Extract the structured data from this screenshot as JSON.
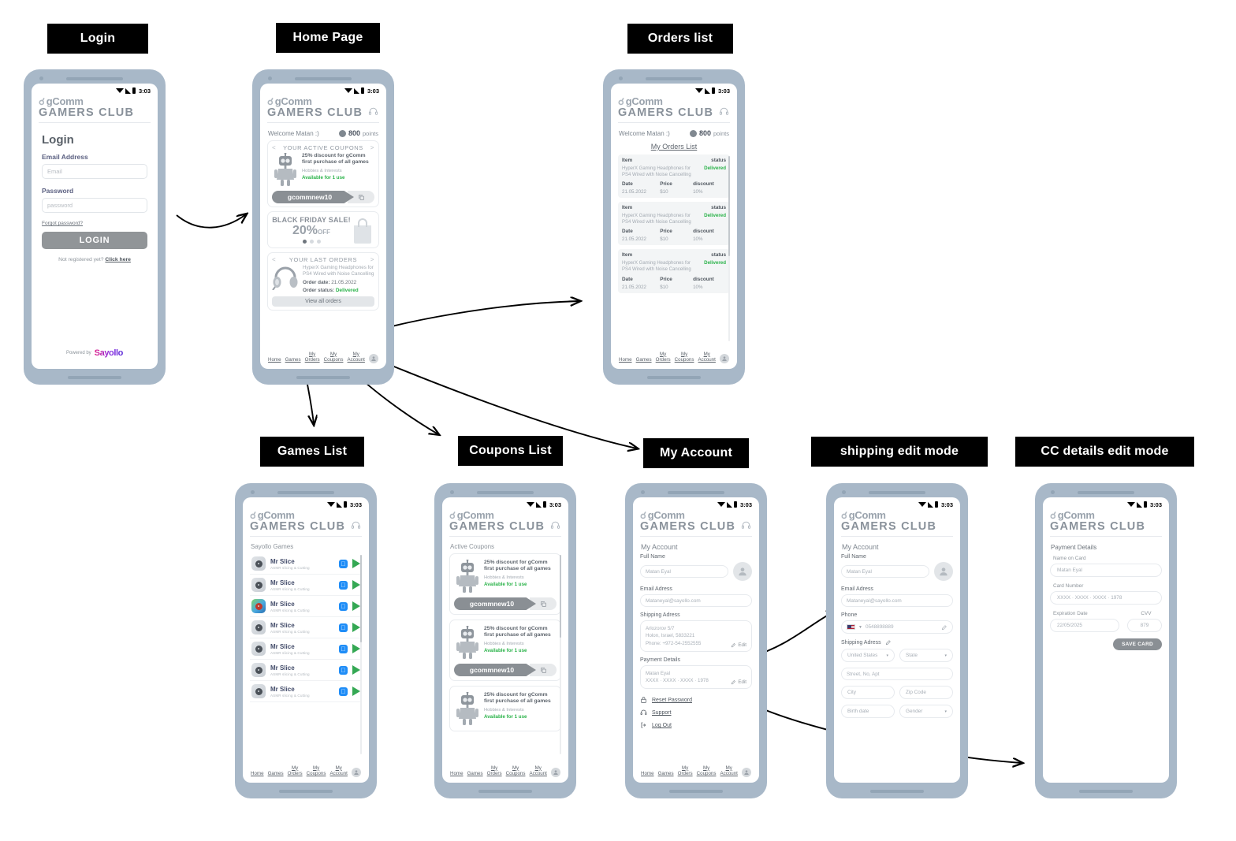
{
  "flow_labels": [
    {
      "id": "login",
      "text": "Login"
    },
    {
      "id": "home",
      "text": "Home Page"
    },
    {
      "id": "orders",
      "text": "Orders list"
    },
    {
      "id": "games",
      "text": "Games List"
    },
    {
      "id": "coupons",
      "text": "Coupons List"
    },
    {
      "id": "account",
      "text": "My Account"
    },
    {
      "id": "shipping",
      "text": "shipping edit mode"
    },
    {
      "id": "cc",
      "text": "CC details edit mode"
    }
  ],
  "status_bar": {
    "time": "3:03"
  },
  "brand": {
    "name": "gComm",
    "club": "GAMERS CLUB"
  },
  "welcome": {
    "text": "Welcome  Matan :)",
    "points_value": "800",
    "points_label": "points"
  },
  "bottom_nav": [
    {
      "line1": "Home",
      "line2": ""
    },
    {
      "line1": "Games",
      "line2": ""
    },
    {
      "line1": "My",
      "line2": "Orders"
    },
    {
      "line1": "My",
      "line2": "Coupons"
    },
    {
      "line1": "My",
      "line2": "Account"
    }
  ],
  "login": {
    "title": "Login",
    "email_label": "Email Address",
    "email_placeholder": "Email",
    "password_label": "Password",
    "password_placeholder": "password",
    "forgot": "Forgot password?",
    "button": "LOGIN",
    "not_registered": "Not registered yet?",
    "click_here": "Click here",
    "powered_by": "Powered by",
    "powered_logo": "Sayollo"
  },
  "home": {
    "coupons_card": {
      "title": "YOUR ACTIVE COUPONS",
      "prev": "<",
      "next": ">",
      "headline": "25% discount for gComm first purchase of all games",
      "category": "Hobbies & Interests",
      "availability": "Available for 1 use",
      "code": "gcommnew10"
    },
    "promo": {
      "title": "BLACK FRIDAY SALE!",
      "percent": "20%",
      "off": "OFF",
      "dots": 3,
      "active_dot": 0
    },
    "orders_card": {
      "title": "YOUR LAST ORDERS",
      "prev": "<",
      "next": ">",
      "product": "HyperX Gaming Headphones for PS4 Wired with Noise Cancelling",
      "order_date_label": "Order date:",
      "order_date": "21.05.2022",
      "order_status_label": "Order status:",
      "order_status": "Delivered",
      "view_all": "View all orders"
    }
  },
  "orders_list": {
    "title": "My Orders List",
    "headers": {
      "item": "Item",
      "status": "status",
      "date": "Date",
      "price": "Price",
      "discount": "discount"
    },
    "rows": [
      {
        "item": "HyperX Gaming Headphones for PS4 Wired with Noise Cancelling",
        "status": "Delivered",
        "date": "21.05.2022",
        "price": "$10",
        "discount": "10%"
      },
      {
        "item": "HyperX Gaming Headphones for PS4 Wired with Noise Cancelling",
        "status": "Delivered",
        "date": "21.05.2022",
        "price": "$10",
        "discount": "10%"
      },
      {
        "item": "HyperX Gaming Headphones for PS4 Wired with Noise Cancelling",
        "status": "Delivered",
        "date": "21.05.2022",
        "price": "$10",
        "discount": "10%"
      }
    ]
  },
  "games_list": {
    "section_title": "Sayollo Games",
    "items": [
      {
        "name": "Mr Slice",
        "sub": "ASMR slicing & Cutting",
        "colorful": false
      },
      {
        "name": "Mr Slice",
        "sub": "ASMR slicing & Cutting",
        "colorful": false
      },
      {
        "name": "Mr Slice",
        "sub": "ASMR slicing & Cutting",
        "colorful": true
      },
      {
        "name": "Mr Slice",
        "sub": "ASMR slicing & Cutting",
        "colorful": false
      },
      {
        "name": "Mr Slice",
        "sub": "ASMR slicing & Cutting",
        "colorful": false
      },
      {
        "name": "Mr Slice",
        "sub": "ASMR slicing & Cutting",
        "colorful": false
      },
      {
        "name": "Mr Slice",
        "sub": "ASMR slicing & Cutting",
        "colorful": false
      }
    ]
  },
  "coupons_list": {
    "section_title": "Active Coupons",
    "items": [
      {
        "headline": "25% discount for gComm first purchase of all games",
        "category": "Hobbies & Interests",
        "availability": "Available for 1 use",
        "code": "gcommnew10"
      },
      {
        "headline": "25% discount for gComm first purchase of all games",
        "category": "Hobbies & Interests",
        "availability": "Available for 1 use",
        "code": "gcommnew10"
      },
      {
        "headline": "25% discount for gComm first purchase of all games",
        "category": "Hobbies & Interests",
        "availability": "Available for 1 use",
        "code": "gcommnew10"
      }
    ]
  },
  "account": {
    "title": "My Account",
    "full_name_label": "Full Name",
    "full_name_value": "Matan Eyal",
    "email_label": "Email Adress",
    "email_value": "Mataneyal@sayollo.com",
    "shipping_label": "Shipping Adress",
    "shipping_line1": "Arlozorov 5/7",
    "shipping_line2": "Holon, Israel, 5833221",
    "shipping_line3": "Phone: +972-54-2552555",
    "edit": "Edit",
    "payment_label": "Payment Details",
    "payment_name": "Matan Eyal",
    "payment_card": "XXXX · XXXX · XXXX · 1978",
    "actions": [
      {
        "icon": "lock-icon",
        "label": "Reset Password"
      },
      {
        "icon": "support-icon",
        "label": "Support"
      },
      {
        "icon": "logout-icon",
        "label": "Log Out"
      }
    ]
  },
  "shipping_edit": {
    "title": "My Account",
    "full_name_label": "Full Name",
    "full_name_value": "Matan Eyal",
    "email_label": "Email Adress",
    "email_value": "Mataneyal@sayollo.com",
    "phone_label": "Phone",
    "phone_value": "0548898889",
    "shipping_label": "Shipping Adress",
    "country": "United States",
    "state": "State",
    "street": "Street, No, Apt",
    "city": "City",
    "zip": "Zip Code",
    "birthdate": "Birth date",
    "gender": "Gender"
  },
  "cc_edit": {
    "title": "Payment Details",
    "name_label": "Name on Card",
    "name_value": "Matan Eyal",
    "number_label": "Card Number",
    "number_value": "XXXX · XXXX · XXXX · 1978",
    "exp_label": "Expiration Date",
    "exp_value": "22/05/2025",
    "cvv_label": "CVV",
    "cvv_value": "879",
    "save_button": "SAVE CARD"
  },
  "colors": {
    "phone_frame": "#a8b8c8",
    "label_chip_bg": "#000000",
    "success_green": "#2bb34a",
    "brand_grey": "#9aa3ad",
    "button_grey": "#8a8f94",
    "sayollo_pink": "#e0218a",
    "sayollo_purple": "#5b2bd6"
  }
}
